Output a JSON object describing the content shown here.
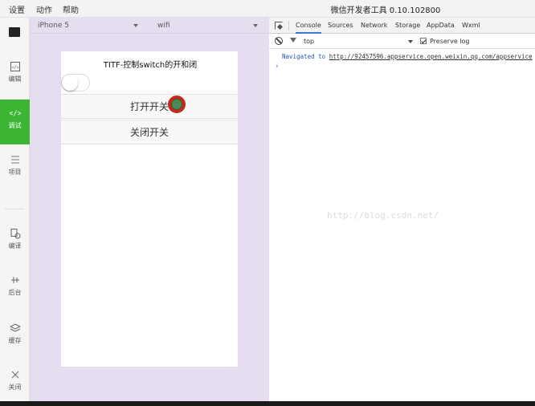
{
  "menubar": {
    "items": [
      "设置",
      "动作",
      "帮助"
    ],
    "title": "微信开发者工具 0.10.102800"
  },
  "sidebar": {
    "items": [
      {
        "label": "编辑",
        "icon": "code-file-icon"
      },
      {
        "label": "调试",
        "icon": "code-brackets-icon",
        "active": true
      },
      {
        "label": "项目",
        "icon": "list-icon"
      },
      {
        "label": "编译",
        "icon": "compile-icon"
      },
      {
        "label": "后台",
        "icon": "background-icon"
      },
      {
        "label": "缓存",
        "icon": "layers-icon"
      },
      {
        "label": "关闭",
        "icon": "close-icon"
      }
    ]
  },
  "simulator": {
    "device": "iPhone 5",
    "network": "wifi"
  },
  "phone": {
    "title": "TITF-控制switch的开和闭",
    "switch_on": false,
    "buttons": [
      "打开开关",
      "关闭开关"
    ]
  },
  "devtools": {
    "tabs": [
      "Console",
      "Sources",
      "Network",
      "Storage",
      "AppData",
      "Wxml"
    ],
    "active_tab": "Console",
    "context": "top",
    "preserve_log_label": "Preserve log",
    "preserve_log_checked": true,
    "log": {
      "prefix": "Navigated to ",
      "url": "http://92457596.appservice.open.weixin.qq.com/appservice"
    },
    "prompt": "›",
    "watermark": "http://blog.csdn.net/"
  },
  "colors": {
    "accent_green": "#3cb534",
    "sim_bg": "#e6def0",
    "tab_active": "#3879d9",
    "cursor_ring": "#c6281f"
  }
}
